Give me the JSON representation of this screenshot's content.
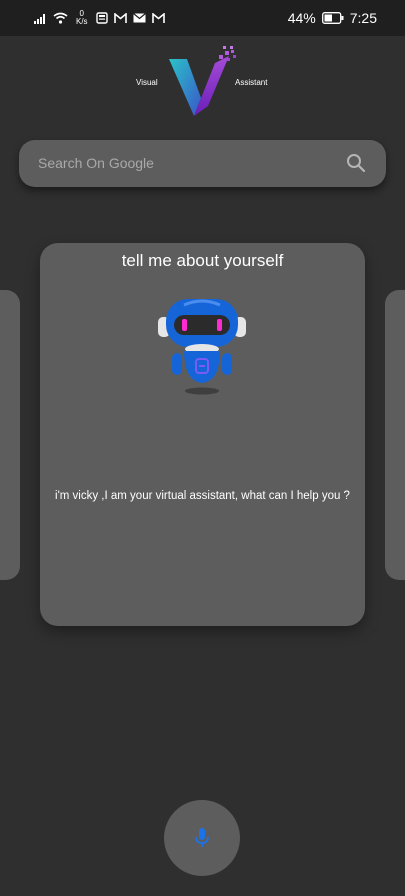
{
  "status_bar": {
    "net_speed_value": "0",
    "net_speed_unit": "K/s",
    "battery_percent": "44%",
    "time": "7:25"
  },
  "logo": {
    "left_text": "Visual",
    "right_text": "Assistant",
    "icon": "v-logo-icon"
  },
  "search": {
    "placeholder": "Search On Google",
    "icon": "search-icon"
  },
  "card": {
    "question": "tell me about yourself",
    "answer": "i'm vicky ,I am your virtual assistant, what can I help you ?",
    "illustration": "robot-icon"
  },
  "mic": {
    "icon": "mic-icon"
  },
  "colors": {
    "background": "#2f2f2f",
    "surface": "#5d5d5d",
    "status_bar": "#1f1f1f",
    "accent_blue": "#1a73e8",
    "accent_magenta": "#e020d0"
  }
}
